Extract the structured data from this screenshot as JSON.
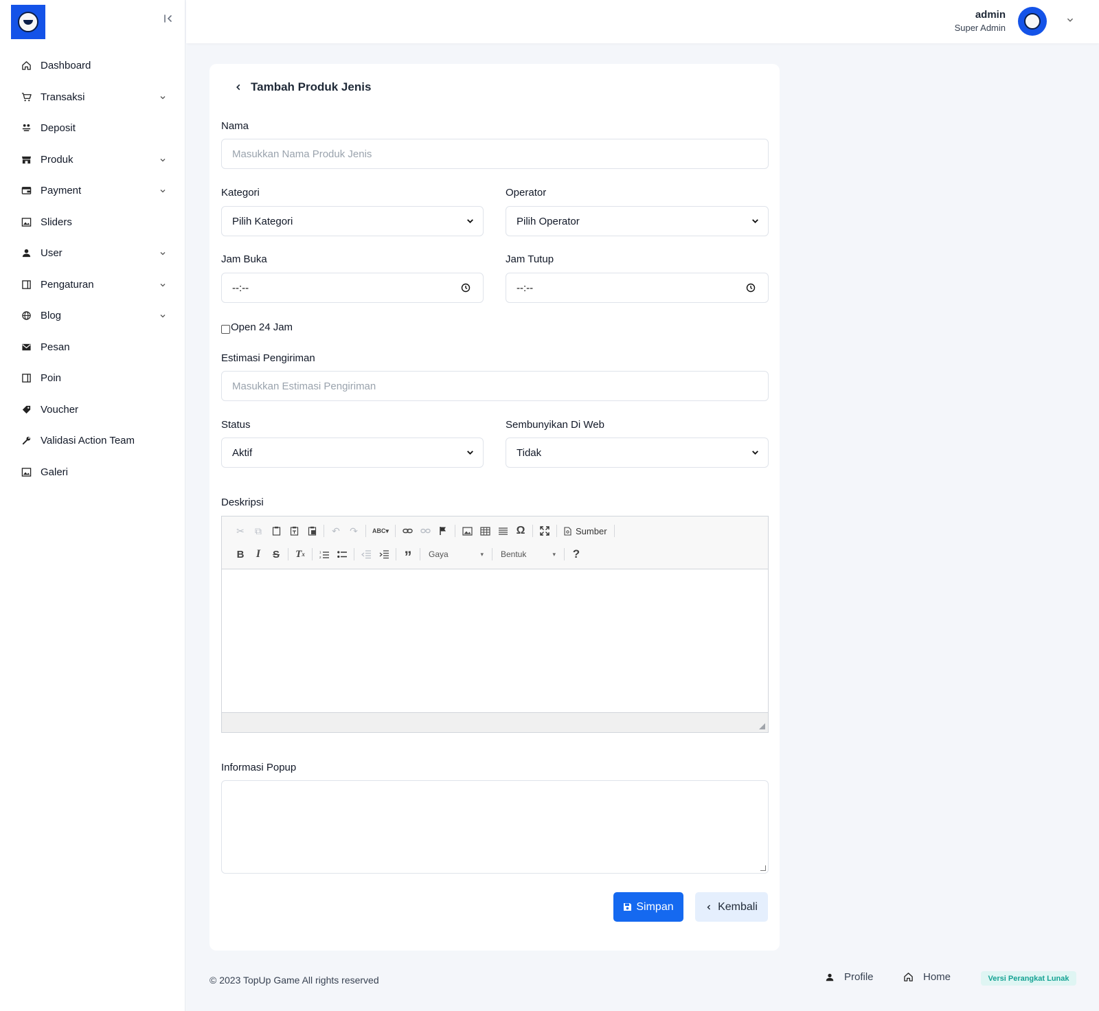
{
  "sidebar": {
    "items": [
      {
        "label": "Dashboard",
        "icon": "home-icon",
        "has_submenu": false
      },
      {
        "label": "Transaksi",
        "icon": "cart-icon",
        "has_submenu": true
      },
      {
        "label": "Deposit",
        "icon": "deposit-icon",
        "has_submenu": false
      },
      {
        "label": "Produk",
        "icon": "store-icon",
        "has_submenu": true
      },
      {
        "label": "Payment",
        "icon": "wallet-icon",
        "has_submenu": true
      },
      {
        "label": "Sliders",
        "icon": "image-icon",
        "has_submenu": false
      },
      {
        "label": "User",
        "icon": "user-icon",
        "has_submenu": true
      },
      {
        "label": "Pengaturan",
        "icon": "panel-icon",
        "has_submenu": true
      },
      {
        "label": "Blog",
        "icon": "globe-icon",
        "has_submenu": true
      },
      {
        "label": "Pesan",
        "icon": "mail-icon",
        "has_submenu": false
      },
      {
        "label": "Poin",
        "icon": "panel-icon",
        "has_submenu": false
      },
      {
        "label": "Voucher",
        "icon": "tag-icon",
        "has_submenu": false
      },
      {
        "label": "Validasi Action Team",
        "icon": "wrench-icon",
        "has_submenu": false
      },
      {
        "label": "Galeri",
        "icon": "image-icon",
        "has_submenu": false
      }
    ]
  },
  "header": {
    "user_name": "admin",
    "user_role": "Super Admin"
  },
  "form": {
    "title": "Tambah Produk Jenis",
    "nama": {
      "label": "Nama",
      "placeholder": "Masukkan Nama Produk Jenis"
    },
    "kategori": {
      "label": "Kategori",
      "value": "Pilih Kategori"
    },
    "operator": {
      "label": "Operator",
      "value": "Pilih Operator"
    },
    "jam_buka": {
      "label": "Jam Buka",
      "value": "--:--"
    },
    "jam_tutup": {
      "label": "Jam Tutup",
      "value": "--:--"
    },
    "open24": {
      "label": "Open 24 Jam",
      "checked": false
    },
    "estimasi": {
      "label": "Estimasi Pengiriman",
      "placeholder": "Masukkan Estimasi Pengiriman"
    },
    "status": {
      "label": "Status",
      "value": "Aktif"
    },
    "sembunyikan": {
      "label": "Sembunyikan Di Web",
      "value": "Tidak"
    },
    "deskripsi": {
      "label": "Deskripsi",
      "source_label": "Sumber",
      "style_combo": "Gaya",
      "format_combo": "Bentuk"
    },
    "popup": {
      "label": "Informasi Popup",
      "value": ""
    },
    "save_label": "Simpan",
    "back_label": "Kembali"
  },
  "footer": {
    "copyright": "© 2023 TopUp Game All rights reserved",
    "profile_label": "Profile",
    "home_label": "Home",
    "version_label": "Versi Perangkat Lunak"
  },
  "colors": {
    "primary": "#1569f0",
    "logo_bg": "#1453e8",
    "version_text": "#16a394"
  }
}
